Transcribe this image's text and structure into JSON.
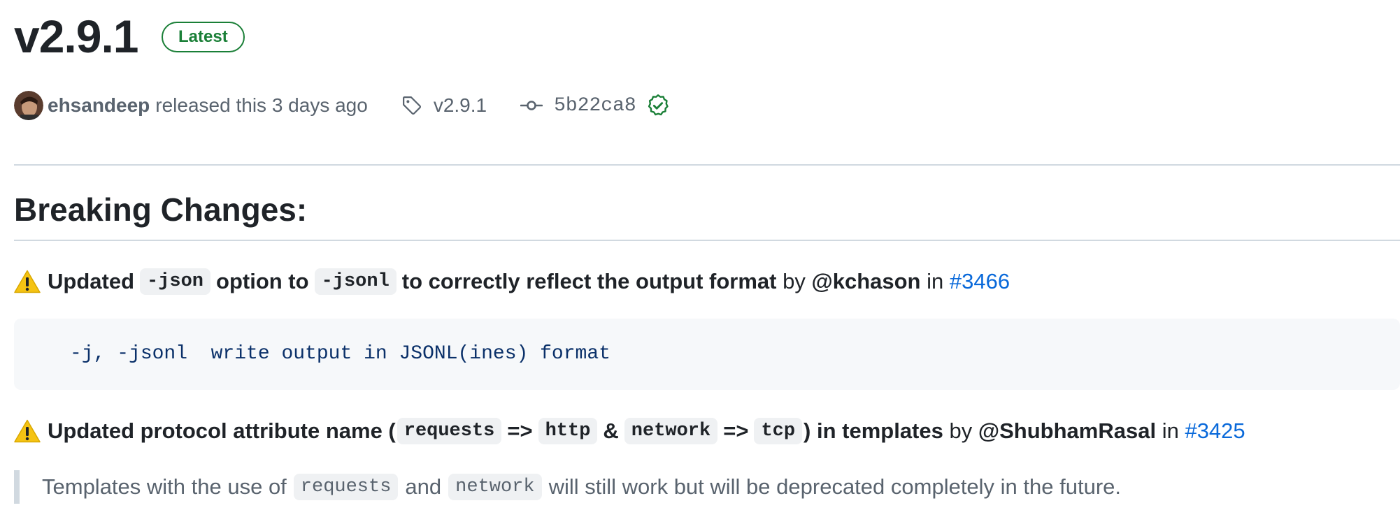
{
  "release": {
    "title": "v2.9.1",
    "badge": "Latest",
    "author": "ehsandeep",
    "released_text": "released this 3 days ago",
    "tag": "v2.9.1",
    "commit_sha": "5b22ca8",
    "verified_color": "#1a7f37"
  },
  "icons": [
    "avatar",
    "tag-icon",
    "commit-icon",
    "verified-icon",
    "warning-icon"
  ],
  "body": {
    "heading": "Breaking Changes:",
    "item1": {
      "emoji": "⚠️",
      "t1": "Updated",
      "c1": "-json",
      "t2": "option to",
      "c2": "-jsonl",
      "t3": "to correctly reflect the output format",
      "by": "by",
      "user": "@kchason",
      "in": "in",
      "pr": "#3466"
    },
    "code_block": "-j, -jsonl  write output in JSONL(ines) format",
    "item2": {
      "emoji": "⚠️",
      "t1": "Updated protocol attribute name (",
      "c1": "requests",
      "t2": "=>",
      "c2": "http",
      "t3": "&",
      "c3": "network",
      "t4": "=>",
      "c4": "tcp",
      "t5": ") in templates",
      "by": "by",
      "user": "@ShubhamRasal",
      "in": "in",
      "pr": "#3425"
    },
    "quote": {
      "t1": "Templates with the use of",
      "c1": "requests",
      "t2": "and",
      "c2": "network",
      "t3": "will still work but will be deprecated completely in the future."
    }
  },
  "colors": {
    "link": "#0969da",
    "latest": "#1a7f37",
    "muted": "#59636e"
  }
}
